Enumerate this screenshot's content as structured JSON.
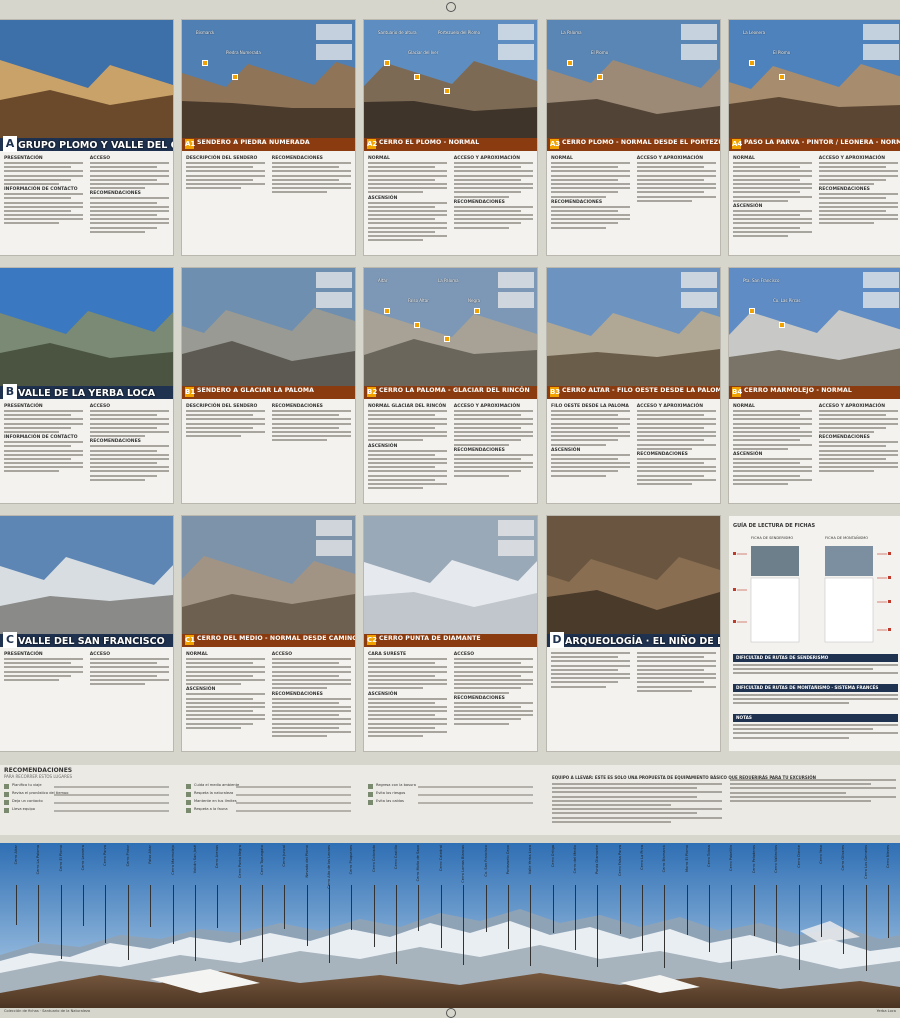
{
  "cards": [
    {
      "num": "A",
      "title": "GRUPO PLOMO Y VALLE DEL CEPO",
      "kind": "section",
      "subs": [
        "PRESENTACIÓN",
        "ACCESO",
        "INFORMACIÓN DE CONTACTO",
        "RECOMENDACIONES"
      ]
    },
    {
      "num": "A1",
      "title": "SENDERO A PIEDRA NUMERADA",
      "kind": "route",
      "subs": [
        "DESCRIPCIÓN DEL SENDERO",
        "RECOMENDACIONES"
      ],
      "peaks": [
        "Bismarck",
        "Piedra Numerada"
      ]
    },
    {
      "num": "A2",
      "title": "CERRO EL PLOMO - NORMAL",
      "kind": "route",
      "subs": [
        "NORMAL",
        "ACCESO Y APROXIMACIÓN",
        "ASCENSIÓN",
        "RECOMENDACIONES"
      ],
      "peaks": [
        "Santuario de altura",
        "Glaciar del Iver",
        "Portezuelo del Plomo"
      ]
    },
    {
      "num": "A3",
      "title": "CERRO PLOMO - NORMAL DESDE EL PORTEZUELO",
      "kind": "route",
      "subs": [
        "NORMAL",
        "ACCESO Y APROXIMACIÓN",
        "RECOMENDACIONES"
      ],
      "peaks": [
        "La Paloma",
        "El Plomo"
      ]
    },
    {
      "num": "A4",
      "title": "PASO LA PARVA - PINTOR / LEONERA - NORMAL",
      "kind": "route",
      "subs": [
        "NORMAL",
        "ACCESO Y APROXIMACIÓN",
        "ASCENSIÓN",
        "RECOMENDACIONES"
      ],
      "peaks": [
        "La Leonera",
        "El Plomo"
      ]
    },
    {
      "num": "B",
      "title": "VALLE DE LA YERBA LOCA",
      "kind": "section",
      "subs": [
        "PRESENTACIÓN",
        "ACCESO",
        "INFORMACIÓN DE CONTACTO",
        "RECOMENDACIONES"
      ]
    },
    {
      "num": "B1",
      "title": "SENDERO A GLACIAR LA PALOMA",
      "kind": "route",
      "subs": [
        "DESCRIPCIÓN DEL SENDERO",
        "RECOMENDACIONES"
      ],
      "peaks": []
    },
    {
      "num": "B2",
      "title": "CERRO LA PALOMA - GLACIAR DEL RINCÓN",
      "kind": "route",
      "subs": [
        "NORMAL GLACIAR DEL RINCÓN",
        "ACCESO Y APROXIMACIÓN",
        "ASCENSIÓN",
        "RECOMENDACIONES"
      ],
      "peaks": [
        "Altar",
        "Falso Altar",
        "La Paloma",
        "Negra"
      ]
    },
    {
      "num": "B3",
      "title": "CERRO ALTAR - FILO OESTE DESDE LA PALOMA",
      "kind": "route",
      "subs": [
        "FILO OESTE DESDE LA PALOMA",
        "ACCESO Y APROXIMACIÓN",
        "ASCENSIÓN",
        "RECOMENDACIONES"
      ],
      "peaks": []
    },
    {
      "num": "B4",
      "title": "CERRO MARMOLEJO - NORMAL",
      "kind": "route",
      "subs": [
        "NORMAL",
        "ACCESO Y APROXIMACIÓN",
        "ASCENSIÓN",
        "RECOMENDACIONES"
      ],
      "peaks": [
        "Pta. San Francisco",
        "Co. Las Pircas"
      ]
    },
    {
      "num": "C",
      "title": "VALLE DEL SAN FRANCISCO",
      "kind": "section",
      "subs": [
        "PRESENTACIÓN",
        "ACCESO"
      ]
    },
    {
      "num": "C1",
      "title": "CERRO DEL MEDIO - NORMAL DESDE CAMINO A LOS BRONCES",
      "kind": "route",
      "subs": [
        "NORMAL",
        "ACCESO",
        "ASCENSIÓN",
        "RECOMENDACIONES"
      ],
      "peaks": []
    },
    {
      "num": "C2",
      "title": "CERRO PUNTA DE DIAMANTE",
      "kind": "route",
      "subs": [
        "CARA SURESTE",
        "ACCESO",
        "ASCENSIÓN",
        "RECOMENDACIONES"
      ],
      "peaks": []
    },
    {
      "num": "D",
      "title": "ARQUEOLOGÍA · EL NIÑO DE EL PLOMO",
      "kind": "section",
      "subs": [
        "",
        ""
      ]
    }
  ],
  "guide": {
    "title": "GUÍA DE LECTURA DE FICHAS",
    "col1": "FICHA DE SENDERISMO",
    "col2": "FICHA DE MONTAÑISMO",
    "bars": [
      "DIFICULTAD DE RUTAS DE SENDERISMO",
      "DIFICULTAD DE RUTAS DE MONTAÑISMO · SISTEMA FRANCÉS",
      "NOTAS"
    ]
  },
  "legend": {
    "title": "RECOMENDACIONES",
    "subtitle": "PARA RECORRER ESTOS LUGARES",
    "col1": [
      "Planifica tu viaje",
      "Revisa el pronóstico del tiempo",
      "Deja un contacto",
      "Lleva equipo"
    ],
    "col2": [
      "Cuida el medio ambiente",
      "Respeta la naturaleza",
      "Mantente en tus límites",
      "Respeta a la fauna"
    ],
    "col3": [
      "Regresa con la basura",
      "Evita los riesgos",
      "Evita las caídas"
    ],
    "col4": "EQUIPO A LLEVAR: ESTE ES SOLO UNA PROPUESTA DE EQUIPAMIENTO BÁSICO QUE REQUERIRÁS PARA TU EXCURSIÓN"
  },
  "panorama": {
    "labels": [
      "Cerro Altar",
      "Cerro La Paloma",
      "Cerro El Plomo",
      "Cerro Leonera",
      "Cerro Parva",
      "Cerro Pintor",
      "Falso Altar",
      "Cerro Marmolejo",
      "Volcán San José",
      "Cerro Arenas",
      "Cerro Punta Negra",
      "Cerro Tupungato",
      "Cerro Juncal",
      "Nevado del Plomo",
      "Cerro Alto de los Leones",
      "Cerro Piuquenes",
      "Cerro Colorado",
      "Cerro Castillo",
      "Cerro Moño de Sapo",
      "Cerro Catedral",
      "Cerro Lomas Blancas",
      "Co. San Francisco",
      "Portezuelo Cepo",
      "Valle Yerba Loca",
      "Cerro Ortiga",
      "Cerro del Medio",
      "Punta Diamante",
      "Cerro Falsa Parva",
      "Cerro La Pirca",
      "Cerro Bismarck",
      "Morro El Plomo",
      "Cerro Tolosa",
      "Cerro Pabellón",
      "Cerro Peladeros",
      "Cerro Vallecitos",
      "Cerro Diente",
      "Cerro Yeso",
      "Cerro Olivares",
      "Cerro Los Gemelos",
      "Cerro Nieves"
    ]
  },
  "footer": {
    "left": "Colección de fichas · Santuario de la Naturaleza",
    "right": "Yerba Loca"
  }
}
